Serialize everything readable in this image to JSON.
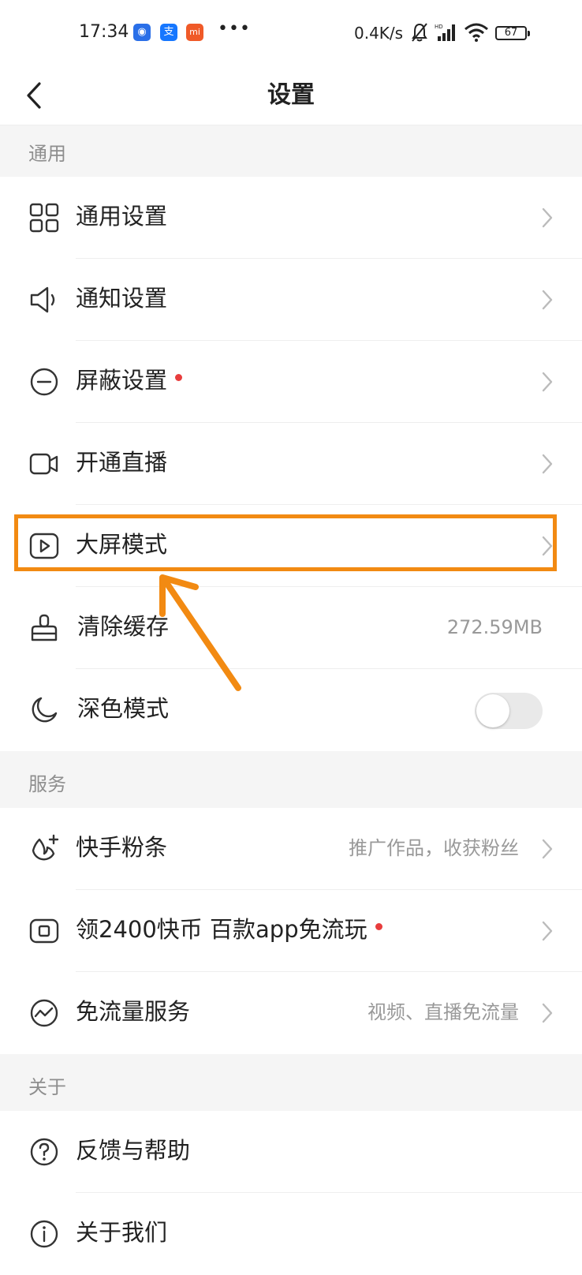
{
  "status_bar": {
    "time": "17:34",
    "app_icons": [
      {
        "name": "map-app-icon",
        "glyph": "◉",
        "color": "#2a6fe8"
      },
      {
        "name": "alipay-icon",
        "glyph": "支",
        "color": "#1677ff"
      },
      {
        "name": "mi-icon",
        "glyph": "mi",
        "color": "#f05a28"
      }
    ],
    "more": "•••",
    "network_speed": "0.4K/s",
    "battery": "67"
  },
  "header": {
    "back_icon": "back-arrow-icon",
    "title": "设置"
  },
  "sections": {
    "general": {
      "label": "通用",
      "items": [
        {
          "icon": "grid-icon",
          "label": "通用设置"
        },
        {
          "icon": "speaker-icon",
          "label": "通知设置"
        },
        {
          "icon": "block-icon",
          "label": "屏蔽设置",
          "badge": "red-dot"
        },
        {
          "icon": "video-camera-icon",
          "label": "开通直播"
        },
        {
          "icon": "play-screen-icon",
          "label": "大屏模式"
        },
        {
          "icon": "broom-icon",
          "label": "清除缓存",
          "value": "272.59MB"
        },
        {
          "icon": "moon-icon",
          "label": "深色模式",
          "toggle": false
        }
      ]
    },
    "services": {
      "label": "服务",
      "items": [
        {
          "icon": "fans-icon",
          "label": "快手粉条",
          "value": "推广作品，收获粉丝"
        },
        {
          "icon": "coin-icon",
          "label": "领2400快币 百款app免流玩",
          "badge": "red-dot"
        },
        {
          "icon": "data-free-icon",
          "label": "免流量服务",
          "value": "视频、直播免流量"
        }
      ]
    },
    "about": {
      "label": "关于",
      "items": [
        {
          "icon": "question-icon",
          "label": "反馈与帮助"
        },
        {
          "icon": "info-icon",
          "label": "关于我们"
        }
      ]
    }
  },
  "colors": {
    "accent_highlight": "#f28a12",
    "red_dot": "#e83d3d",
    "section_bg": "#f5f5f5",
    "secondary_text": "#999999"
  }
}
